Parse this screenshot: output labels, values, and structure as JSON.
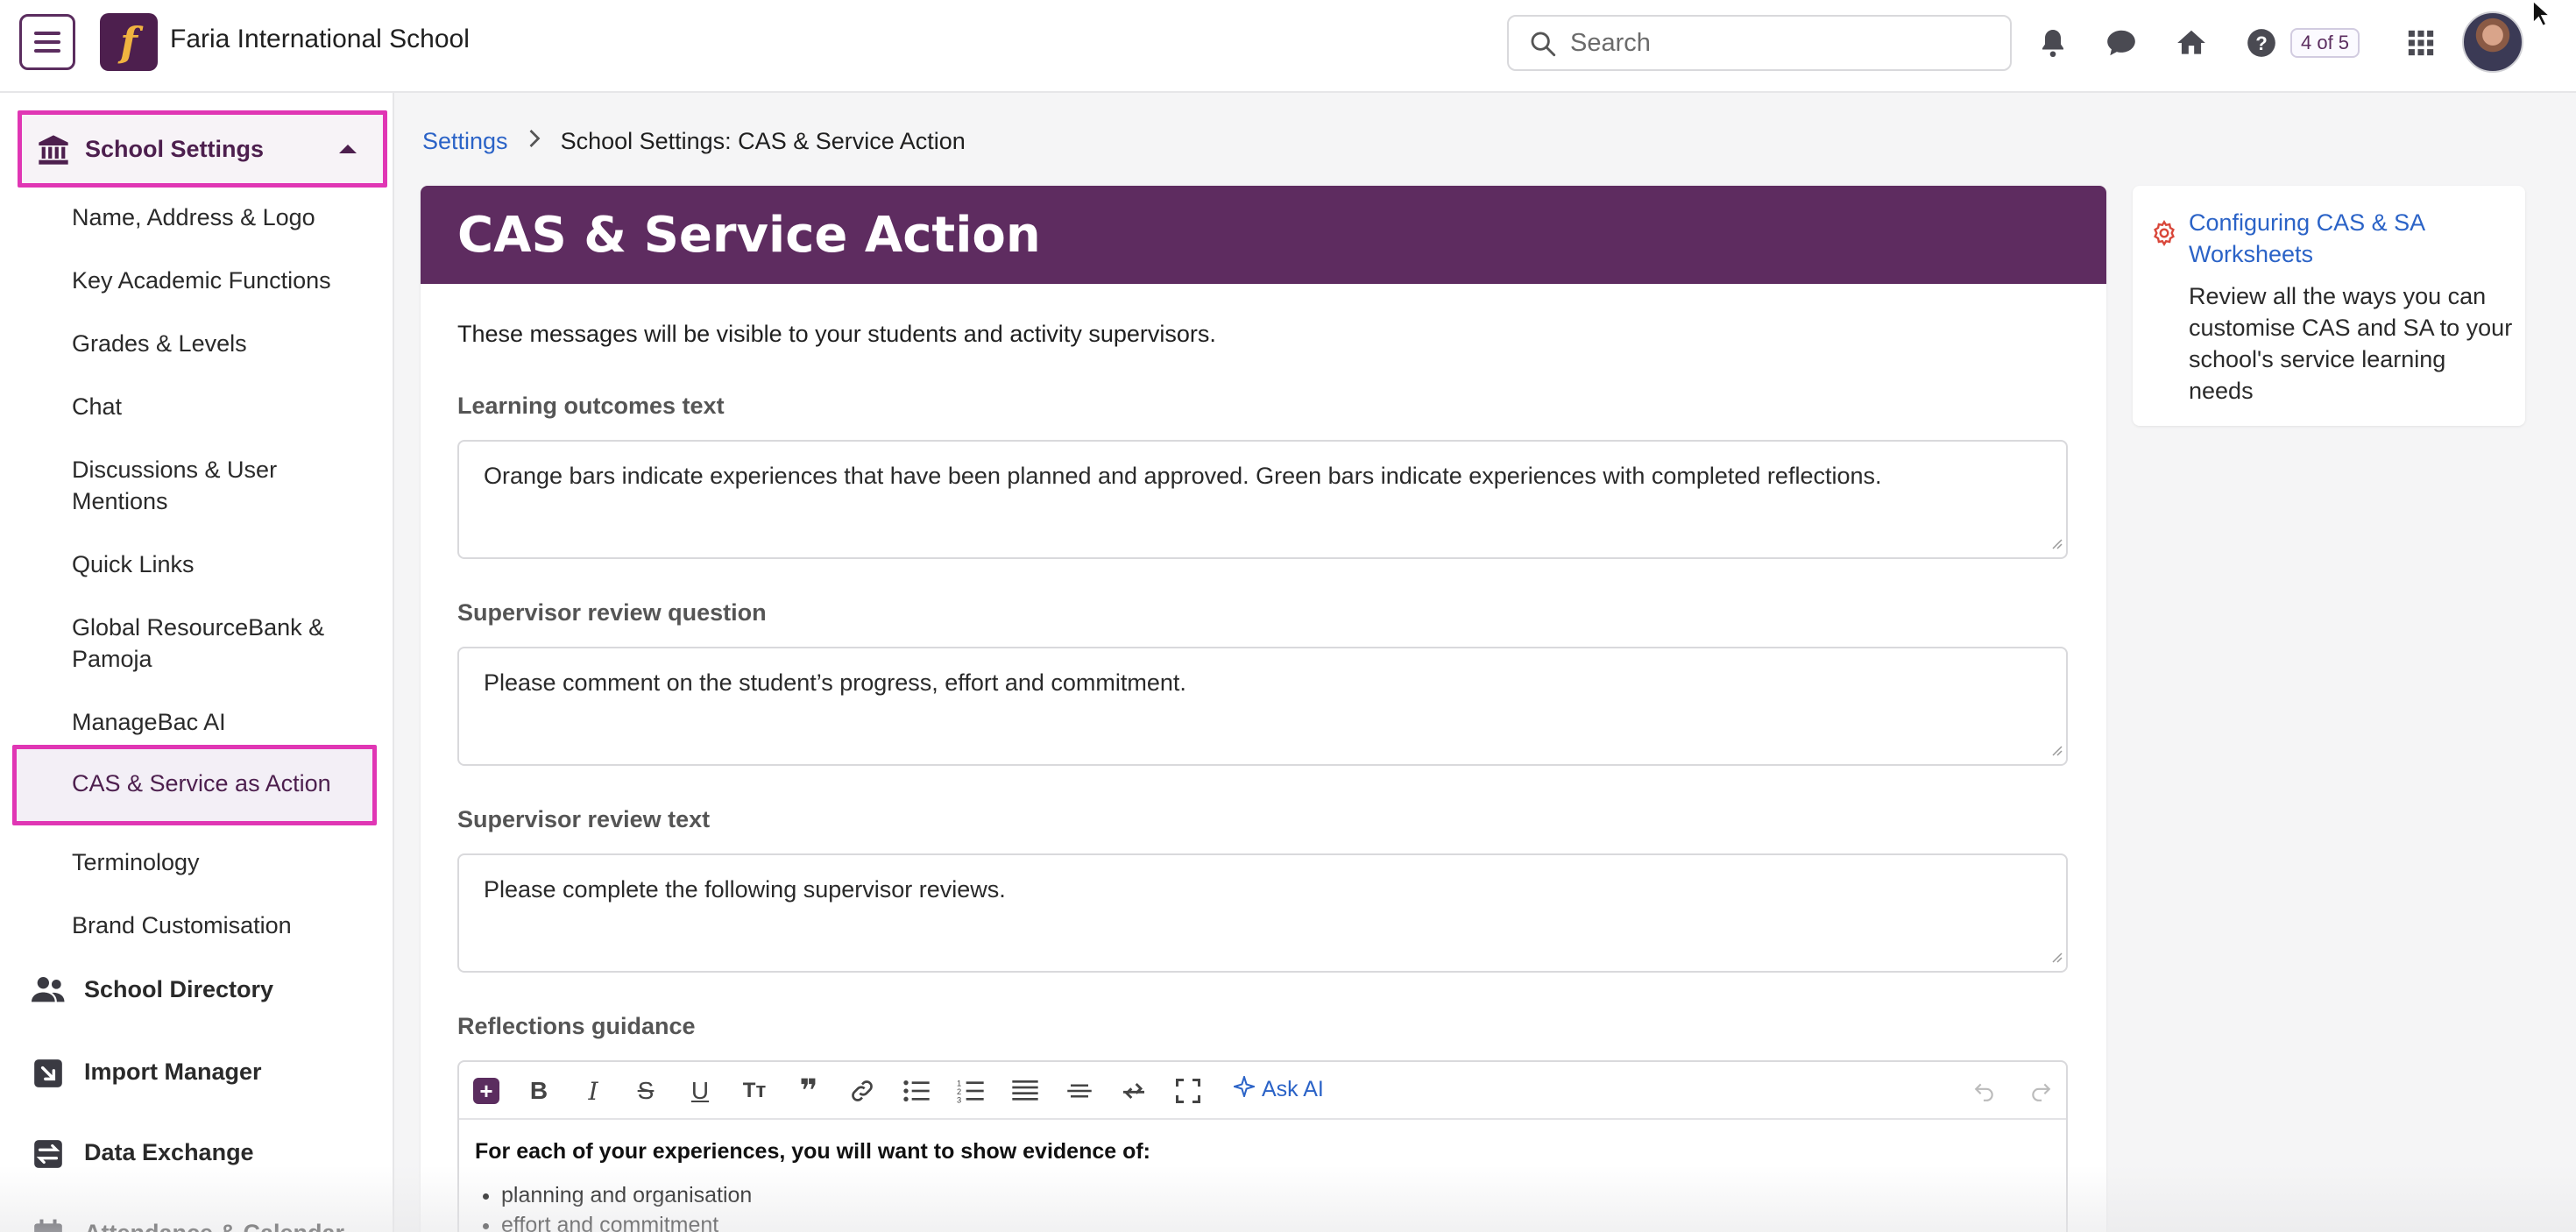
{
  "header": {
    "school_name": "Faria International School",
    "logo_letter": "f",
    "search_placeholder": "Search",
    "counter": "4 of 5"
  },
  "sidebar": {
    "section_title": "School Settings",
    "sub_items": [
      "Name, Address & Logo",
      "Key Academic Functions",
      "Grades & Levels",
      "Chat",
      "Discussions & User Mentions",
      "Quick Links",
      "Global ResourceBank & Pamoja",
      "ManageBac AI",
      "CAS & Service as Action",
      "Terminology",
      "Brand Customisation"
    ],
    "active_item": "CAS & Service as Action",
    "main_items": [
      {
        "label": "School Directory",
        "icon": "people-icon"
      },
      {
        "label": "Import Manager",
        "icon": "import-icon"
      },
      {
        "label": "Data Exchange",
        "icon": "data-exchange-icon"
      },
      {
        "label": "Attendance & Calendar",
        "icon": "calendar-icon"
      }
    ]
  },
  "breadcrumb": {
    "root": "Settings",
    "current": "School Settings: CAS & Service Action"
  },
  "main": {
    "title": "CAS & Service Action",
    "intro": "These messages will be visible to your students and activity supervisors.",
    "fields": [
      {
        "label": "Learning outcomes text",
        "value": "Orange bars indicate experiences that have been planned and approved. Green bars indicate experiences with completed reflections."
      },
      {
        "label": "Supervisor review question",
        "value": "Please comment on the student’s progress, effort and commitment."
      },
      {
        "label": "Supervisor review text",
        "value": "Please complete the following supervisor reviews."
      }
    ],
    "reflections": {
      "label": "Reflections guidance",
      "ask_ai": "Ask AI",
      "body_title": "For each of your experiences, you will want to show evidence of:",
      "bullets": [
        "planning and organisation",
        "effort and commitment"
      ]
    }
  },
  "help": {
    "link": "Configuring CAS & SA Worksheets",
    "text": "Review all the ways you can customise CAS and SA to your school's service learning needs"
  },
  "colors": {
    "brand_purple": "#5e2c60",
    "highlight_pink": "#e036b4",
    "link_blue": "#2b63c7",
    "logo_accent": "#f0b340"
  }
}
